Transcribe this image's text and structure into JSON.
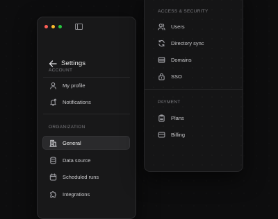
{
  "window": {
    "title": "Settings"
  },
  "left_panel": {
    "account_label": "ACCOUNT",
    "account_items": [
      {
        "label": "My profile",
        "icon": "user-icon"
      },
      {
        "label": "Notifications",
        "icon": "bell-icon"
      }
    ],
    "organization_label": "ORGANIZATION",
    "organization_items": [
      {
        "label": "General",
        "icon": "building-icon",
        "active": true
      },
      {
        "label": "Data source",
        "icon": "database-icon"
      },
      {
        "label": "Scheduled runs",
        "icon": "calendar-icon"
      },
      {
        "label": "Integrations",
        "icon": "puzzle-icon"
      }
    ]
  },
  "right_panel": {
    "access_label": "ACCESS & SECURITY",
    "access_items": [
      {
        "label": "Users",
        "icon": "users-icon"
      },
      {
        "label": "Directory sync",
        "icon": "sync-icon"
      },
      {
        "label": "Domains",
        "icon": "domains-icon"
      },
      {
        "label": "SSO",
        "icon": "lock-icon"
      }
    ],
    "payment_label": "PAYMENT",
    "payment_items": [
      {
        "label": "Plans",
        "icon": "clipboard-icon"
      },
      {
        "label": "Billing",
        "icon": "card-icon"
      }
    ]
  },
  "colors": {
    "background": "#0d0d0e",
    "window": "#181819",
    "active_item": "#2a2a2c",
    "traffic_red": "#ff5f57",
    "traffic_yellow": "#febc2e",
    "traffic_green": "#28c840"
  }
}
